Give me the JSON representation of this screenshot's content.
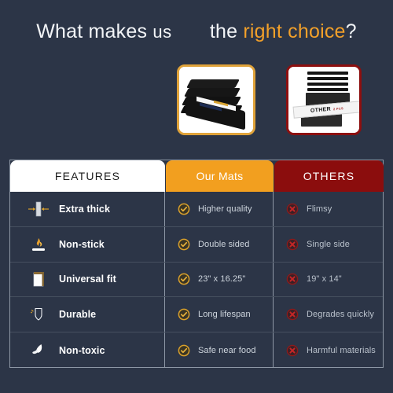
{
  "headline": {
    "part1": "What makes",
    "part2": "us",
    "part3": "the",
    "accent": "right choice",
    "suffix": "?"
  },
  "thumbnails": {
    "ours": {
      "name": "our-mats-product-photo",
      "border_color": "#e0a33a"
    },
    "others": {
      "name": "others-product-photo",
      "border_color": "#8d0f0f",
      "label": "OTHER",
      "label_sub": "2 PCS"
    }
  },
  "table": {
    "headers": {
      "features": "FEATURES",
      "ours": "Our Mats",
      "others": "OTHERS"
    },
    "header_colors": {
      "features_bg": "#ffffff",
      "ours_bg": "#f29f1f",
      "others_bg": "#8b0d0d"
    },
    "rows": [
      {
        "icon": "thickness-caliper-icon",
        "feature": "Extra thick",
        "ours": "Higher quality",
        "others": "Flimsy"
      },
      {
        "icon": "non-stick-pan-icon",
        "feature": "Non-stick",
        "ours": "Double sided",
        "others": "Single side"
      },
      {
        "icon": "universal-fit-sheet-icon",
        "feature": "Universal fit",
        "ours": "23\" x 16.25\"",
        "others": "19\" x 14\""
      },
      {
        "icon": "shield-durable-icon",
        "feature": "Durable",
        "ours": "Long lifespan",
        "others": "Degrades quickly"
      },
      {
        "icon": "leaf-non-toxic-icon",
        "feature": "Non-toxic",
        "ours": "Safe near food",
        "others": "Harmful materials"
      }
    ],
    "marks": {
      "positive_icon": "check-circle-icon",
      "positive_color": "#d9a02b",
      "negative_icon": "x-circle-icon",
      "negative_color": "#8e1a1a"
    }
  },
  "theme": {
    "background": "#2c3547",
    "accent_orange": "#f2a02a",
    "accent_red": "#8b0d0d",
    "text_light": "#f2f4f7"
  }
}
